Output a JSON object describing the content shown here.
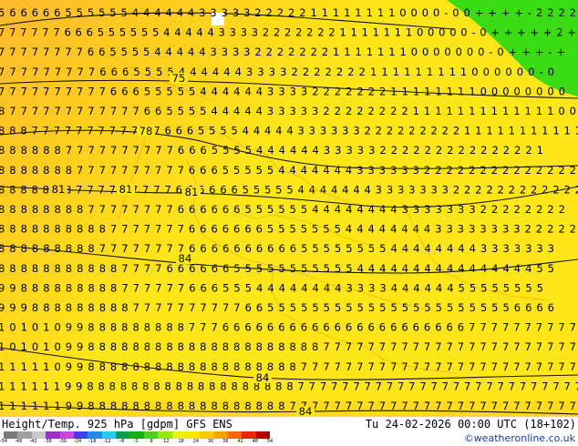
{
  "footer": {
    "title": "Height/Temp. 925 hPa [gdpm] GFS ENS",
    "datetime": "Tu 24-02-2026 00:00 UTC (18+102)",
    "credit": "©weatheronline.co.uk"
  },
  "colorbar": {
    "labels": [
      "-54",
      "-48",
      "-42",
      "-38",
      "-30",
      "-24",
      "-18",
      "-12",
      "-8",
      "0",
      "8",
      "12",
      "18",
      "24",
      "30",
      "36",
      "42",
      "48",
      "54"
    ],
    "colors": [
      "#7a7a7a",
      "#a0a0a0",
      "#c8c8c8",
      "#9b32c8",
      "#c846e6",
      "#4040e6",
      "#1e8cf0",
      "#28c8f0",
      "#00a050",
      "#0fb40f",
      "#50d214",
      "#96e614",
      "#e6f01e",
      "#ffe600",
      "#ffc800",
      "#ffa000",
      "#ff6400",
      "#e62800",
      "#b40000"
    ]
  },
  "contour_labels": [
    "75",
    "78",
    "81",
    "81",
    "81",
    "84",
    "84",
    "84"
  ],
  "map": {
    "colors": {
      "green": "#3cdc14",
      "yellow": "#ffe619",
      "amber": "#ffcd1e",
      "orange": "#ffb92d"
    },
    "grid_rows": [
      "5666665555554444443333322222111111110000-00++++-2222",
      "7777776665555554444433332222222111111100000-0+++++2+",
      "77777777665555444443333222222211111110000000-0+++-+",
      "777777777666555544444433332222222111111111000000-0",
      "777777777766655555444444333322222221111111100000000",
      "8777777777777665555444443333322222222111111111111100",
      "88877777777777766655554444433333322222222211111111111",
      "8888887777777777666555544444433333222222222222221",
      "8888888777777777766655555444444433333322222222222222",
      "88888887777777776666665555544444443333333222222222222",
      "888888887777777766666655555544444444333333322222222",
      "8888888888777777766666665555555444444443333333322222",
      "88888888877777777666666666655555555444444443333333",
      "88888888888777766666655555555555444444444444444455",
      "9988888888877777766655544444444333344444455555555",
      "99988888888877777777776655555555555555555555556666",
      "1010109988888888877766666666666666666666667777777777",
      "1010109988888888888888888888877777777777777777777777",
      "1111109988888888888888888887777777777777777777777777",
      "11111199888888888888888888877777777777777777777777777",
      "1111119988888888888888888877777777777777777777777777"
    ]
  }
}
